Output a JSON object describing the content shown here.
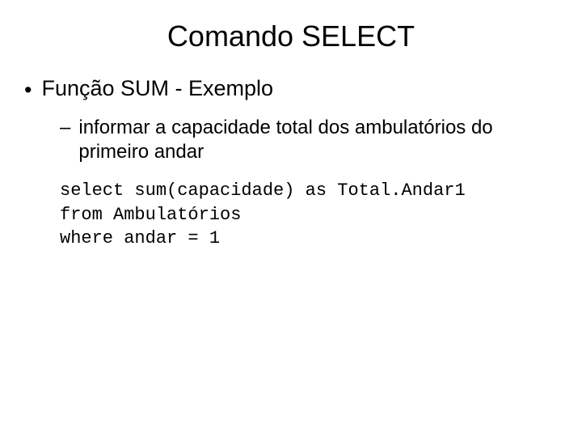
{
  "title": "Comando SELECT",
  "bullet": {
    "marker": "•",
    "text": "Função SUM - Exemplo"
  },
  "sub": {
    "marker": "–",
    "text": "informar a capacidade total dos ambulatórios do primeiro andar"
  },
  "code": {
    "line1": "select sum(capacidade) as Total.Andar1",
    "line2": "from Ambulatórios",
    "line3": "where andar = 1"
  }
}
